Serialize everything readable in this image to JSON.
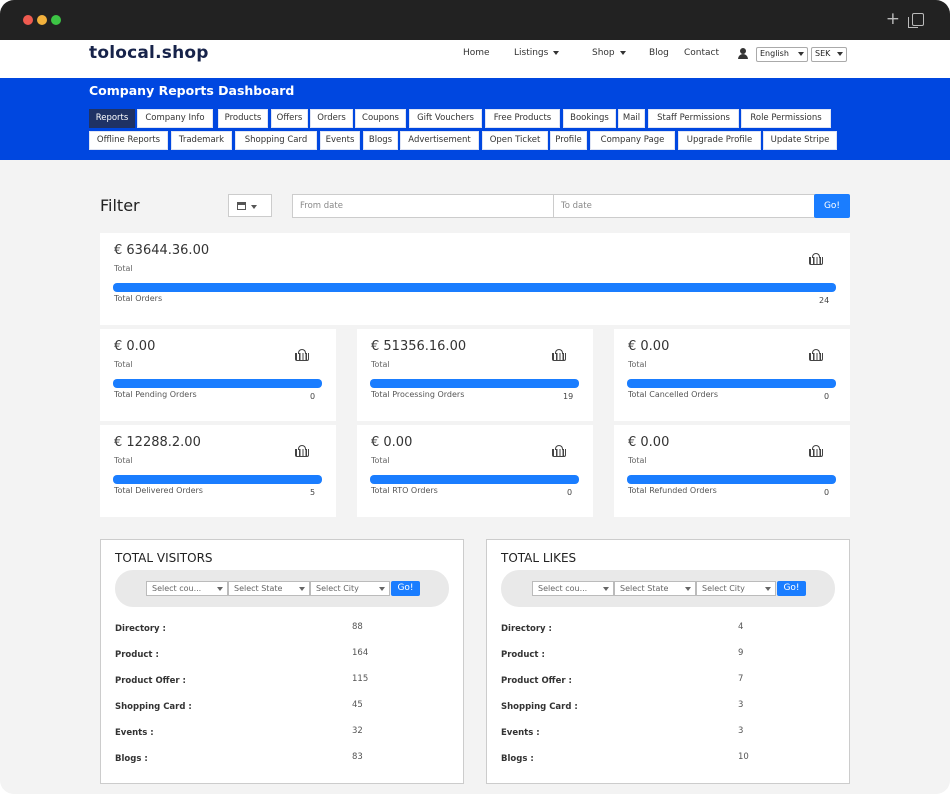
{
  "navbar": {
    "logo": "tolocal.shop",
    "items": [
      {
        "label": "Home",
        "dropdown": false
      },
      {
        "label": "Listings",
        "dropdown": true
      },
      {
        "label": "Shop",
        "dropdown": true
      },
      {
        "label": "Blog",
        "dropdown": false
      },
      {
        "label": "Contact",
        "dropdown": false
      }
    ],
    "language": "English",
    "currency": "SEK"
  },
  "header": {
    "title": "Company Reports Dashboard",
    "tabs_row1": [
      "Reports",
      "Company Info",
      "Products",
      "Offers",
      "Orders",
      "Coupons",
      "Gift Vouchers",
      "Free Products",
      "Bookings",
      "Mail",
      "Staff Permissions",
      "Role Permissions"
    ],
    "tabs_row2": [
      "Offline Reports",
      "Trademark",
      "Shopping Card",
      "Events",
      "Blogs",
      "Advertisement",
      "Open Ticket",
      "Profile",
      "Company Page",
      "Upgrade Profile",
      "Update Stripe"
    ],
    "active_tab": "Reports"
  },
  "filter": {
    "label": "Filter",
    "from_placeholder": "From date",
    "to_placeholder": "To date",
    "go_label": "Go!"
  },
  "summary": {
    "amount": "€ 63644.36.00",
    "sub": "Total",
    "bar_label": "Total Orders",
    "count": "24",
    "bar_fill": 1.0
  },
  "cards": [
    {
      "amount": "€ 0.00",
      "sub": "Total",
      "bar_label": "Total Pending Orders",
      "count": "0"
    },
    {
      "amount": "€ 51356.16.00",
      "sub": "Total",
      "bar_label": "Total Processing Orders",
      "count": "19"
    },
    {
      "amount": "€ 0.00",
      "sub": "Total",
      "bar_label": "Total Cancelled Orders",
      "count": "0"
    },
    {
      "amount": "€ 12288.2.00",
      "sub": "Total",
      "bar_label": "Total Delivered Orders",
      "count": "5"
    },
    {
      "amount": "€ 0.00",
      "sub": "Total",
      "bar_label": "Total RTO Orders",
      "count": "0"
    },
    {
      "amount": "€ 0.00",
      "sub": "Total",
      "bar_label": "Total Refunded Orders",
      "count": "0"
    }
  ],
  "panels": [
    {
      "title": "TOTAL VISITORS",
      "country_placeholder": "Select cou...",
      "state_placeholder": "Select State",
      "city_placeholder": "Select City",
      "go_label": "Go!",
      "stats": [
        {
          "label": "Directory :",
          "value": "88"
        },
        {
          "label": "Product :",
          "value": "164"
        },
        {
          "label": "Product Offer :",
          "value": "115"
        },
        {
          "label": "Shopping Card :",
          "value": "45"
        },
        {
          "label": "Events :",
          "value": "32"
        },
        {
          "label": "Blogs :",
          "value": "83"
        }
      ]
    },
    {
      "title": "TOTAL LIKES",
      "country_placeholder": "Select cou...",
      "state_placeholder": "Select State",
      "city_placeholder": "Select City",
      "go_label": "Go!",
      "stats": [
        {
          "label": "Directory :",
          "value": "4"
        },
        {
          "label": "Product :",
          "value": "9"
        },
        {
          "label": "Product Offer :",
          "value": "7"
        },
        {
          "label": "Shopping Card :",
          "value": "3"
        },
        {
          "label": "Events :",
          "value": "3"
        },
        {
          "label": "Blogs :",
          "value": "10"
        }
      ]
    }
  ],
  "colors": {
    "brand_blue": "#0047e0",
    "accent_blue": "#1a7dff",
    "active_tab": "#1f3265",
    "logo": "#17234a"
  },
  "icons": [
    "basket-icon",
    "calendar-icon",
    "user-icon",
    "close-dot-icon",
    "plus-icon",
    "copy-icon"
  ]
}
